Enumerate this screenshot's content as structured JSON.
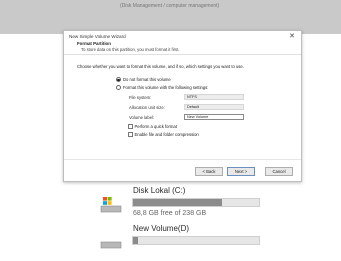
{
  "background_window": {
    "caption": "(Disk Management / computer management)"
  },
  "wizard": {
    "title": "New Simple Volume Wizard",
    "close_glyph": "✕",
    "heading": "Format Partition",
    "subheading": "To store data on this partition, you must format it first.",
    "intro": "Choose whether you want to format this volume, and if so, which settings you want to use.",
    "options": {
      "no_format_label": "Do not format this volume",
      "format_label": "Format this volume with the following settings:",
      "selected": "no_format"
    },
    "fields": {
      "file_system_label": "File system:",
      "file_system_value": "NTFS",
      "allocation_label": "Allocation unit size:",
      "allocation_value": "Default",
      "volume_label_label": "Volume label:",
      "volume_label_value": "New Volume"
    },
    "checkboxes": {
      "quick_format": "Perform a quick format",
      "compression": "Enable file and folder compression"
    },
    "buttons": {
      "back": "< Back",
      "next": "Next >",
      "cancel": "Cancel"
    }
  },
  "drives": [
    {
      "name": "Disk Lokal (C:)",
      "free_text": "68,8 GB free of 238 GB",
      "used_fraction": 0.71
    },
    {
      "name": "New Volume(D)",
      "used_fraction": 0.04
    }
  ]
}
